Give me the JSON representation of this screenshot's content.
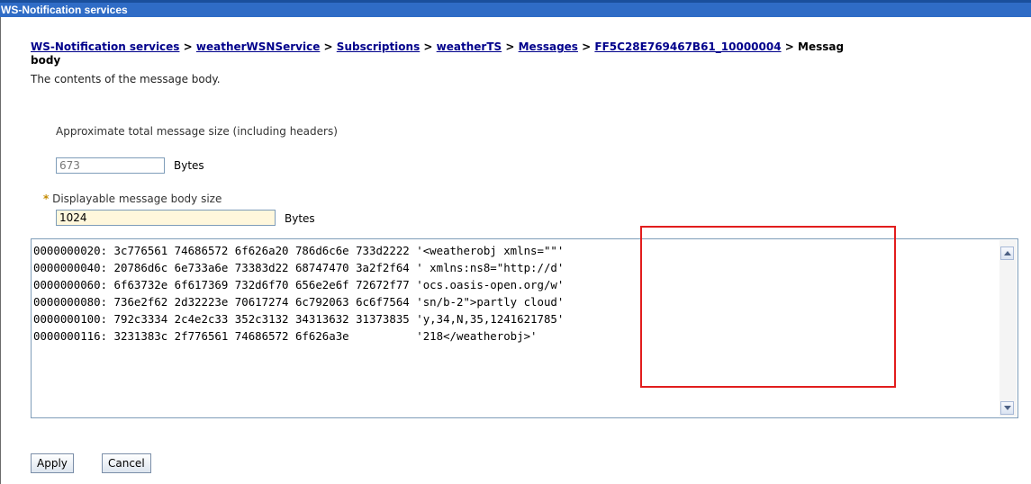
{
  "window": {
    "title": "WS-Notification services"
  },
  "breadcrumb": {
    "items": [
      "WS-Notification services",
      "weatherWSNService",
      "Subscriptions",
      "weatherTS",
      "Messages",
      "FF5C28E769467B61_10000004"
    ],
    "separator": ">",
    "current_head": "Messag",
    "current_tail": "body"
  },
  "description": "The contents of the message body.",
  "total_size": {
    "label": "Approximate total message size (including headers)",
    "value": "673",
    "unit": "Bytes"
  },
  "display_size": {
    "required_marker": "*",
    "label": "Displayable message body size",
    "value": "1024",
    "unit": "Bytes"
  },
  "hex_dump": [
    {
      "offset": "0000000020:",
      "hex": "3c776561 74686572 6f626a20 786d6c6e 733d2222",
      "text": "'<weatherobj xmlns=\"\"'"
    },
    {
      "offset": "0000000040:",
      "hex": "20786d6c 6e733a6e 73383d22 68747470 3a2f2f64",
      "text": "' xmlns:ns8=\"http://d'"
    },
    {
      "offset": "0000000060:",
      "hex": "6f63732e 6f617369 732d6f70 656e2e6f 72672f77",
      "text": "'ocs.oasis-open.org/w'"
    },
    {
      "offset": "0000000080:",
      "hex": "736e2f62 2d32223e 70617274 6c792063 6c6f7564",
      "text": "'sn/b-2\">partly cloud'"
    },
    {
      "offset": "0000000100:",
      "hex": "792c3334 2c4e2c33 352c3132 34313632 31373835",
      "text": "'y,34,N,35,1241621785'"
    },
    {
      "offset": "0000000116:",
      "hex": "3231383c 2f776561 74686572 6f626a3e         ",
      "text": "'218</weatherobj>'"
    }
  ],
  "buttons": {
    "apply": "Apply",
    "cancel": "Cancel"
  },
  "colors": {
    "titlebar": "#2f6cc6",
    "link": "#00008b",
    "highlight": "#e21d1d",
    "required_field_bg": "#fff7dc"
  }
}
